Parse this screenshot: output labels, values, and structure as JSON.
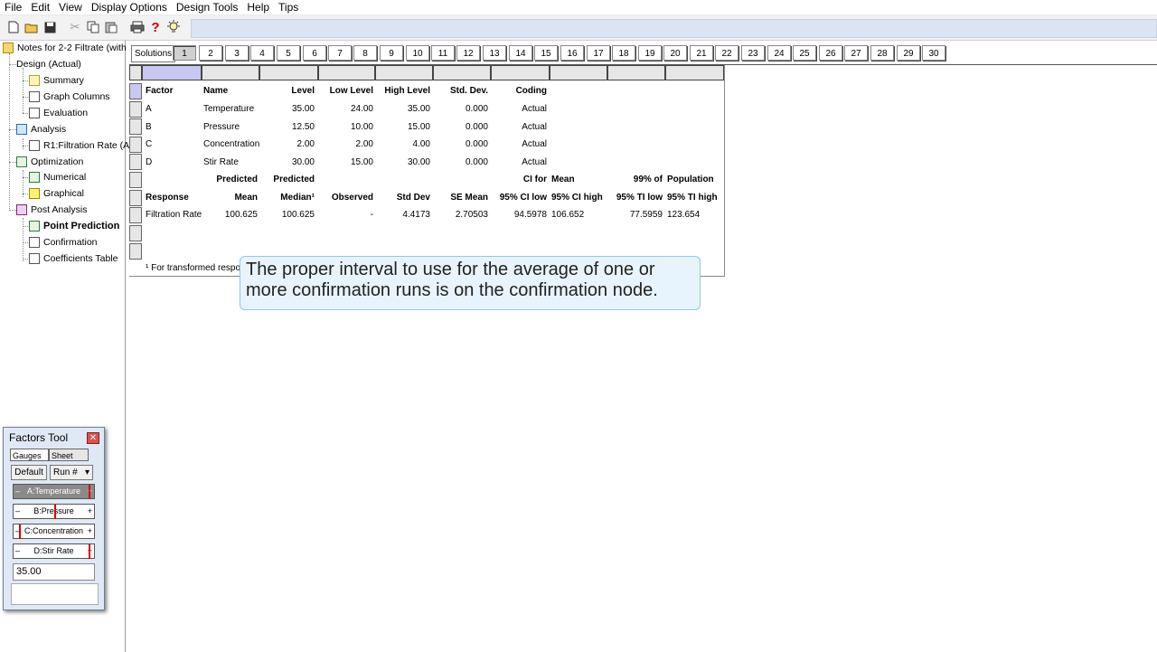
{
  "menu": [
    "File",
    "Edit",
    "View",
    "Display Options",
    "Design Tools",
    "Help",
    "Tips"
  ],
  "toolbar": {
    "icons": [
      "new-file-icon",
      "open-folder-icon",
      "save-icon",
      "cut-icon",
      "copy-icon",
      "paste-icon",
      "print-icon",
      "help-icon",
      "tip-bulb-icon"
    ]
  },
  "tree": {
    "root": "Notes for 2-2 Filtrate (with",
    "design": "Design (Actual)",
    "summary": "Summary",
    "graph_columns": "Graph Columns",
    "evaluation": "Evaluation",
    "analysis": "Analysis",
    "r1": "R1:Filtration Rate (A",
    "optimization": "Optimization",
    "numerical": "Numerical",
    "graphical": "Graphical",
    "post_analysis": "Post Analysis",
    "point_prediction": "Point Prediction",
    "confirmation": "Confirmation",
    "coefficients_table": "Coefficients Table"
  },
  "solutions": {
    "label": "Solutions",
    "tabs": [
      "1",
      "2",
      "3",
      "4",
      "5",
      "6",
      "7",
      "8",
      "9",
      "10",
      "11",
      "12",
      "13",
      "14",
      "15",
      "16",
      "17",
      "18",
      "19",
      "20",
      "21",
      "22",
      "23",
      "24",
      "25",
      "26",
      "27",
      "28",
      "29",
      "30"
    ],
    "active": "1"
  },
  "table": {
    "factor_headers": [
      "Factor",
      "Name",
      "Level",
      "Low Level",
      "High Level",
      "Std. Dev.",
      "Coding"
    ],
    "factors": [
      [
        "A",
        "Temperature",
        "35.00",
        "24.00",
        "35.00",
        "0.000",
        "Actual"
      ],
      [
        "B",
        "Pressure",
        "12.50",
        "10.00",
        "15.00",
        "0.000",
        "Actual"
      ],
      [
        "C",
        "Concentration",
        "2.00",
        "2.00",
        "4.00",
        "0.000",
        "Actual"
      ],
      [
        "D",
        "Stir Rate",
        "30.00",
        "15.00",
        "30.00",
        "0.000",
        "Actual"
      ]
    ],
    "response_header_top": [
      "",
      "Predicted",
      "Predicted",
      "",
      "",
      "",
      "CI for",
      "Mean",
      "99% of",
      "Population"
    ],
    "response_header_bottom": [
      "Response",
      "Mean",
      "Median¹",
      "Observed",
      "Std Dev",
      "SE Mean",
      "95% CI low",
      "95% CI high",
      "95% TI low",
      "95% TI high"
    ],
    "response_row": [
      "Filtration Rate",
      "100.625",
      "100.625",
      "-",
      "4.4173",
      "2.70503",
      "94.5978",
      "106.652",
      "77.5959",
      "123.654"
    ],
    "footnote": "¹ For transformed respo"
  },
  "tooltip": "The proper interval to use for the average of one or more confirmation runs is on the confirmation node.",
  "factors_tool": {
    "title": "Factors Tool",
    "tab_gauges": "Gauges",
    "tab_sheet": "Sheet",
    "default_btn": "Default",
    "run_select": "Run #",
    "gauges": [
      {
        "label": "A:Temperature",
        "level": 1.0
      },
      {
        "label": "B:Pressure",
        "level": 0.5
      },
      {
        "label": "C:Concentration",
        "level": 0.0
      },
      {
        "label": "D:Stir Rate",
        "level": 1.0
      }
    ],
    "value": "35.00"
  }
}
